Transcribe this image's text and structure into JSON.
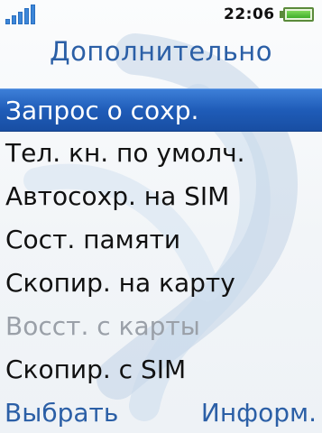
{
  "status_bar": {
    "time": "22:06",
    "signal_strength": 5,
    "battery_level": 1.0
  },
  "colors": {
    "accent": "#2b5fa6",
    "selection": "#1f5cb8",
    "disabled_text": "#9aa0a8",
    "battery": "#3fae2a"
  },
  "header": {
    "title": "Дополнительно"
  },
  "menu": {
    "items": [
      {
        "label": "Запрос о сохр.",
        "selected": true,
        "disabled": false
      },
      {
        "label": "Тел. кн. по умолч.",
        "selected": false,
        "disabled": false
      },
      {
        "label": "Автосохр. на SIM",
        "selected": false,
        "disabled": false
      },
      {
        "label": "Сост. памяти",
        "selected": false,
        "disabled": false
      },
      {
        "label": "Скопир. на карту",
        "selected": false,
        "disabled": false
      },
      {
        "label": "Восст. с карты",
        "selected": false,
        "disabled": true
      },
      {
        "label": "Скопир. с SIM",
        "selected": false,
        "disabled": false
      }
    ]
  },
  "softkeys": {
    "left": "Выбрать",
    "right": "Информ."
  }
}
